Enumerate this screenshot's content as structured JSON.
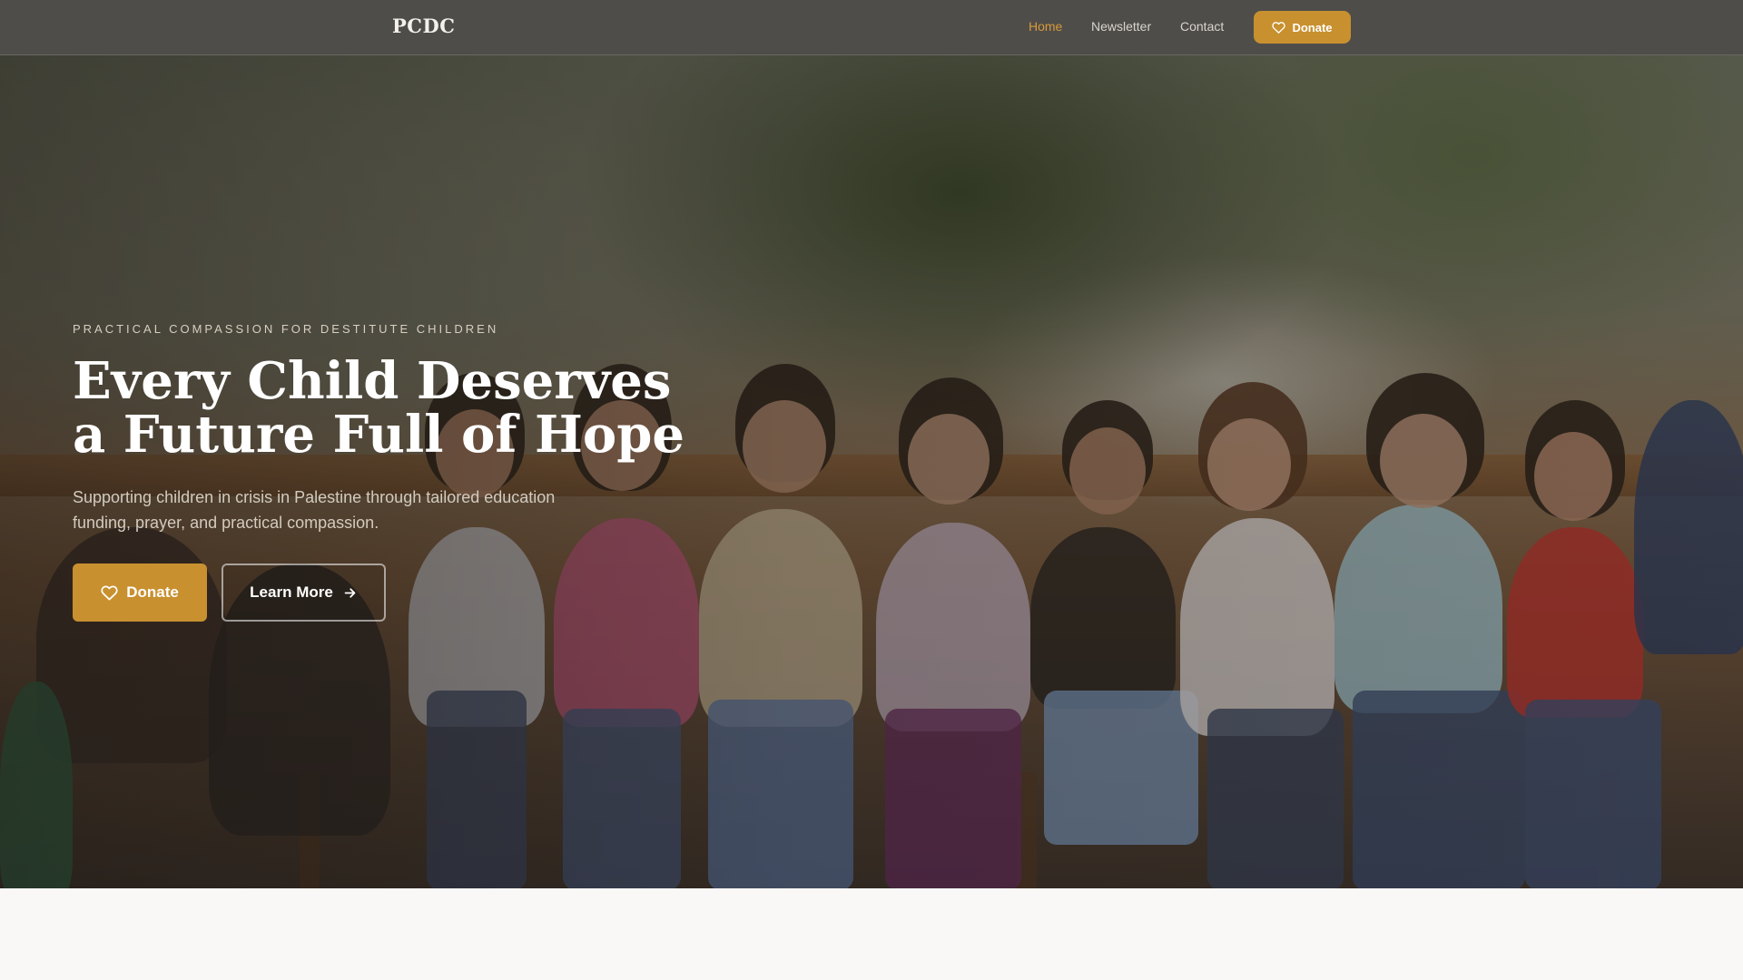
{
  "header": {
    "logo": "PCDC",
    "nav": {
      "home": "Home",
      "newsletter": "Newsletter",
      "contact": "Contact"
    },
    "donate_label": "Donate"
  },
  "hero": {
    "eyebrow": "PRACTICAL COMPASSION FOR DESTITUTE CHILDREN",
    "headline": "Every Child Deserves\na Future Full of Hope",
    "subtext": "Supporting children in crisis in Palestine through tailored education funding, prayer, and practical compassion.",
    "donate_label": "Donate",
    "learn_more_label": "Learn More",
    "background_image": "children sitting on a wooden bench outdoors"
  },
  "icons": {
    "heart": "heart-icon",
    "arrow": "arrow-right-icon"
  },
  "colors": {
    "accent": "#c8902f",
    "active_link": "#d69a3a",
    "navbar": "#4f4d4a",
    "page_bg": "#f9f8f6"
  }
}
